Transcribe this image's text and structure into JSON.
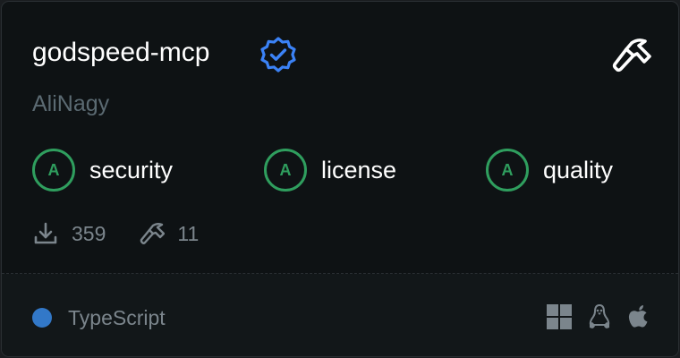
{
  "server": {
    "name": "godspeed-mcp",
    "author": "AliNagy",
    "verified": true
  },
  "grades": [
    {
      "grade": "A",
      "label": "security"
    },
    {
      "grade": "A",
      "label": "license"
    },
    {
      "grade": "A",
      "label": "quality"
    }
  ],
  "stats": {
    "downloads": "359",
    "tools": "11"
  },
  "footer": {
    "language": "TypeScript",
    "language_color": "#3278c8",
    "platforms": [
      "windows-icon",
      "linux-icon",
      "apple-icon"
    ]
  },
  "colors": {
    "grade_accent": "#2f9e5e",
    "verified_accent": "#3b82f6",
    "muted_text": "#7b858c"
  }
}
